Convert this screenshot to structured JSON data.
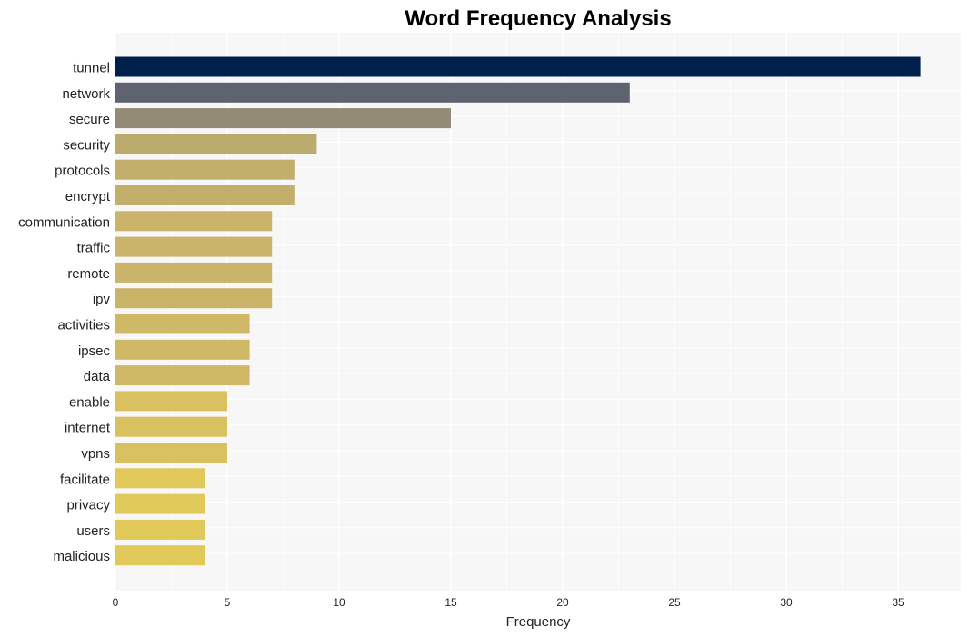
{
  "chart_data": {
    "type": "bar",
    "orientation": "horizontal",
    "title": "Word Frequency Analysis",
    "xlabel": "Frequency",
    "ylabel": "",
    "xlim": [
      0,
      37.8
    ],
    "xticks": [
      0,
      5,
      10,
      15,
      20,
      25,
      30,
      35
    ],
    "grid": true,
    "categories": [
      "tunnel",
      "network",
      "secure",
      "security",
      "protocols",
      "encrypt",
      "communication",
      "traffic",
      "remote",
      "ipv",
      "activities",
      "ipsec",
      "data",
      "enable",
      "internet",
      "vpns",
      "facilitate",
      "privacy",
      "users",
      "malicious"
    ],
    "values": [
      36,
      23,
      15,
      9,
      8,
      8,
      7,
      7,
      7,
      7,
      6,
      6,
      6,
      5,
      5,
      5,
      4,
      4,
      4,
      4
    ],
    "colors": [
      "#00204c",
      "#5f6370",
      "#948b76",
      "#bbab6d",
      "#c2af6b",
      "#c2af6b",
      "#c9b469",
      "#c9b469",
      "#c9b469",
      "#c9b469",
      "#d0b966",
      "#d0b966",
      "#d0b966",
      "#d9c15f",
      "#d9c15f",
      "#d9c15f",
      "#e0c959",
      "#e0c959",
      "#e0c959",
      "#e0c959"
    ],
    "background": "#f7f7f7"
  }
}
